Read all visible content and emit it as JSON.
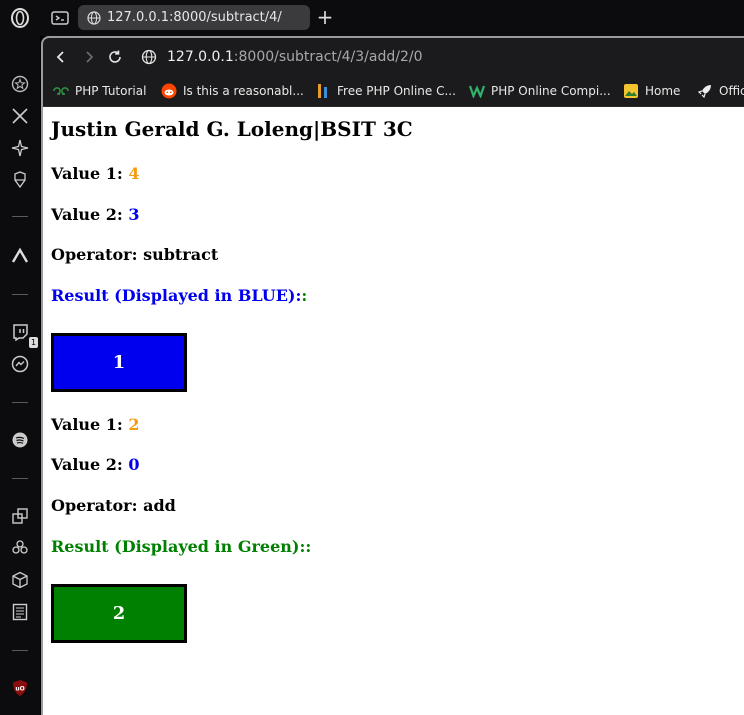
{
  "browser": {
    "tab_title": "127.0.0.1:8000/subtract/4/",
    "url_host": "127.0.0.1",
    "url_path": ":8000/subtract/4/3/add/2/0",
    "bookmarks": [
      {
        "label": "PHP Tutorial",
        "icon": "geeksforgeeks-icon"
      },
      {
        "label": "Is this a reasonabl...",
        "icon": "reddit-icon"
      },
      {
        "label": "Free PHP Online C...",
        "icon": "code-icon"
      },
      {
        "label": "PHP Online Compi...",
        "icon": "w-logo-icon"
      },
      {
        "label": "Home",
        "icon": "image-icon"
      },
      {
        "label": "Offic",
        "icon": "rocket-icon"
      }
    ],
    "sidebar_badge": "1"
  },
  "page": {
    "heading": "Justin Gerald G. Loleng|BSIT 3C",
    "ops": [
      {
        "value1_label": "Value 1:",
        "value1": "4",
        "value2_label": "Value 2:",
        "value2": "3",
        "operator_label": "Operator:",
        "operator": "subtract",
        "result_label": "Result (Displayed in BLUE):",
        "result_suffix": ":",
        "result": "1",
        "result_color": "#0000ee"
      },
      {
        "value1_label": "Value 1:",
        "value1": "2",
        "value2_label": "Value 2:",
        "value2": "0",
        "operator_label": "Operator:",
        "operator": "add",
        "result_label": "Result (Displayed in Green):",
        "result_suffix": ":",
        "result": "2",
        "result_color": "#008000"
      }
    ]
  }
}
